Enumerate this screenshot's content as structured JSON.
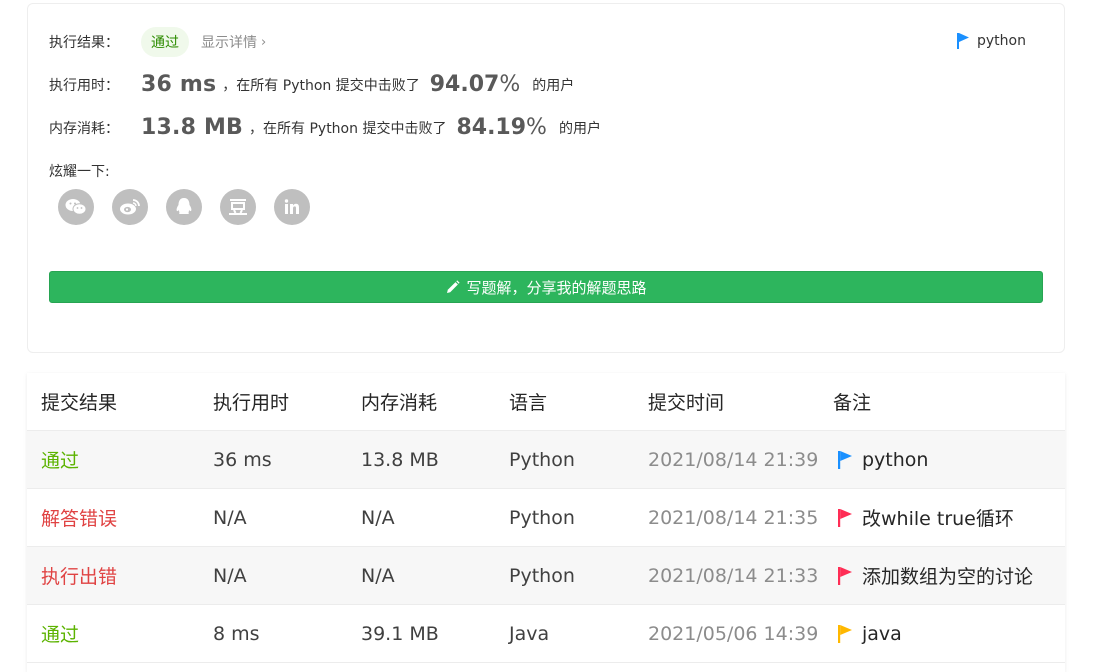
{
  "summary": {
    "result_label": "执行结果：",
    "result_status": "通过",
    "detail_link": "显示详情",
    "language_tag": "python",
    "runtime_label": "执行用时：",
    "runtime_value": "36 ms",
    "runtime_text": "，在所有 Python 提交中击败了",
    "runtime_pct": "94.07",
    "pct_symbol": "%",
    "users_text": "的用户",
    "memory_label": "内存消耗：",
    "memory_value": "13.8 MB",
    "memory_text": "，在所有 Python 提交中击败了",
    "memory_pct": "84.19",
    "share_label": "炫耀一下:",
    "share_icons": [
      "wechat-icon",
      "weibo-icon",
      "qq-icon",
      "douban-icon",
      "linkedin-icon"
    ],
    "write_button": "写题解，分享我的解题思路"
  },
  "colors": {
    "success": "#5cb300",
    "error": "#e04343",
    "flag_blue": "#1a90ff",
    "flag_red": "#ff2d55",
    "flag_yellow": "#ffb800",
    "button_green": "#2db55d"
  },
  "table": {
    "headers": [
      "提交结果",
      "执行用时",
      "内存消耗",
      "语言",
      "提交时间",
      "备注"
    ],
    "rows": [
      {
        "result": "通过",
        "runtime": "36 ms",
        "memory": "13.8 MB",
        "lang": "Python",
        "time": "2021/08/14 21:39",
        "note": "python",
        "flag": "blue"
      },
      {
        "result": "解答错误",
        "runtime": "N/A",
        "memory": "N/A",
        "lang": "Python",
        "time": "2021/08/14 21:35",
        "note": "改while true循环",
        "flag": "red"
      },
      {
        "result": "执行出错",
        "runtime": "N/A",
        "memory": "N/A",
        "lang": "Python",
        "time": "2021/08/14 21:33",
        "note": "添加数组为空的讨论",
        "flag": "red"
      },
      {
        "result": "通过",
        "runtime": "8 ms",
        "memory": "39.1 MB",
        "lang": "Java",
        "time": "2021/05/06 14:39",
        "note": "java",
        "flag": "yellow"
      }
    ]
  }
}
